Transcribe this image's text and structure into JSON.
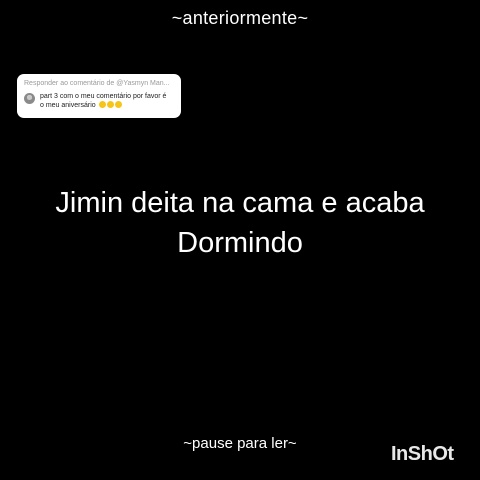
{
  "top_caption": "~anteriormente~",
  "reply_card": {
    "header": "Responder ao comentário de @Yasmyn Man...",
    "line1": "part 3 com o meu comentário por favor é",
    "line2": "o meu aniversário",
    "emojis": [
      "face-icon",
      "face-icon",
      "face-icon"
    ]
  },
  "main_text": {
    "line1": "Jimin deita na cama e acaba",
    "line2": "Dormindo"
  },
  "bottom_caption": "~pause para ler~",
  "watermark": "InShOt"
}
